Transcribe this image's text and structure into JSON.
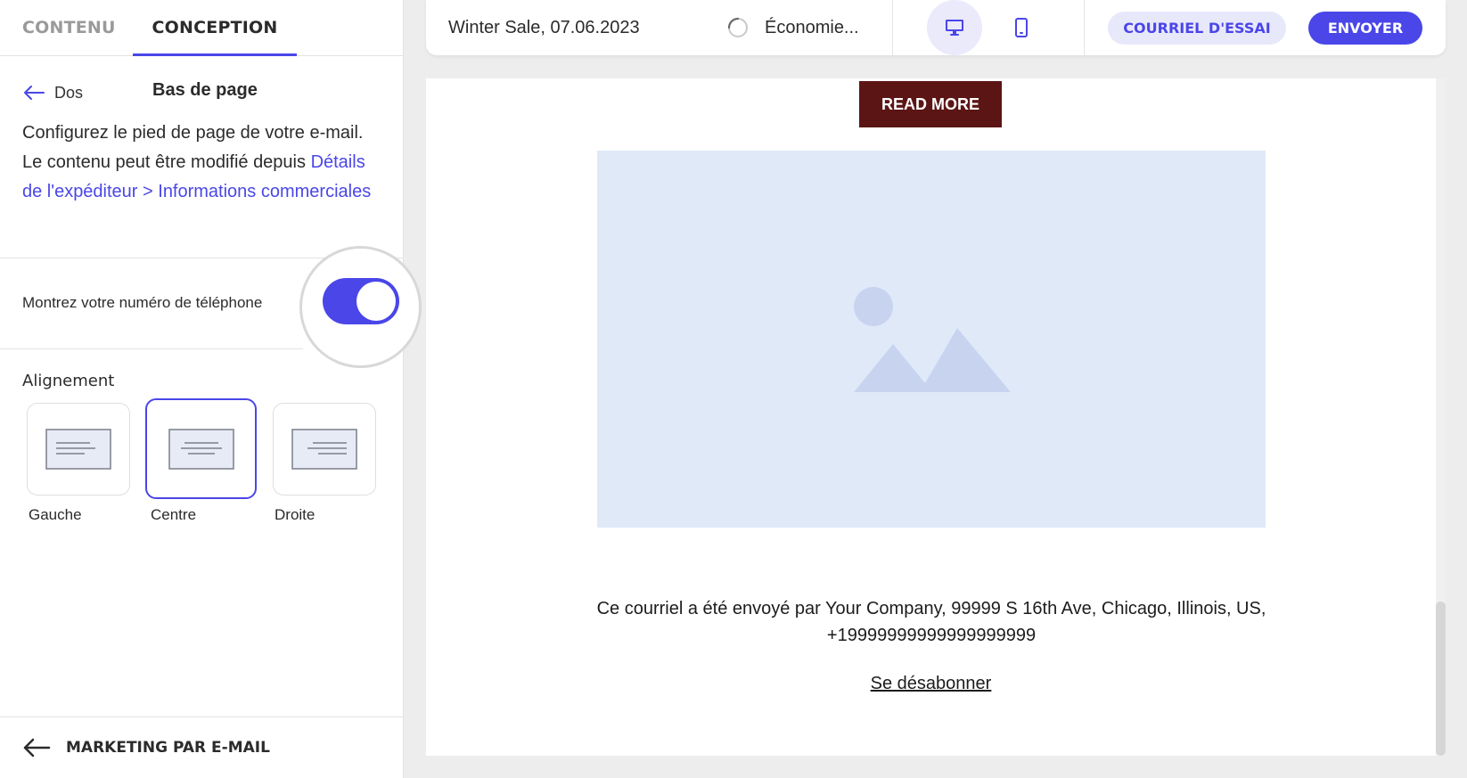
{
  "colors": {
    "accent": "#4a46e8",
    "accent_light": "#e8e8fb",
    "read_more_bg": "#5c1515",
    "placeholder_bg": "#dfe9f8"
  },
  "left_panel": {
    "tabs": [
      {
        "label": "CONTENU",
        "active": false
      },
      {
        "label": "CONCEPTION",
        "active": true
      }
    ],
    "back_label": "Dos",
    "title": "Bas de page",
    "description": "Configurez le pied de page de votre e-mail. Le contenu peut être modifié depuis",
    "description_link": "Détails de l'expéditeur > Informations commerciales",
    "toggle": {
      "label": "Montrez votre numéro de téléphone",
      "on": true
    },
    "alignment": {
      "title": "Alignement",
      "options": [
        {
          "label": "Gauche",
          "selected": false
        },
        {
          "label": "Centre",
          "selected": true
        },
        {
          "label": "Droite",
          "selected": false
        }
      ]
    },
    "bottom_nav_label": "MARKETING PAR E-MAIL"
  },
  "topbar": {
    "email_name": "Winter Sale, 07.06.2023",
    "saving_status": "Économie...",
    "device_desktop_icon": "desktop-icon",
    "device_mobile_icon": "mobile-icon",
    "test_email_label": "COURRIEL D'ESSAI",
    "send_label": "ENVOYER"
  },
  "email_preview": {
    "read_more_label": "READ MORE",
    "image_icon": "image-placeholder-icon",
    "footer_text": "Ce courriel a été envoyé par Your Company, 99999 S 16th Ave, Chicago, Illinois, US, +19999999999999999999",
    "unsubscribe_label": "Se désabonner"
  }
}
